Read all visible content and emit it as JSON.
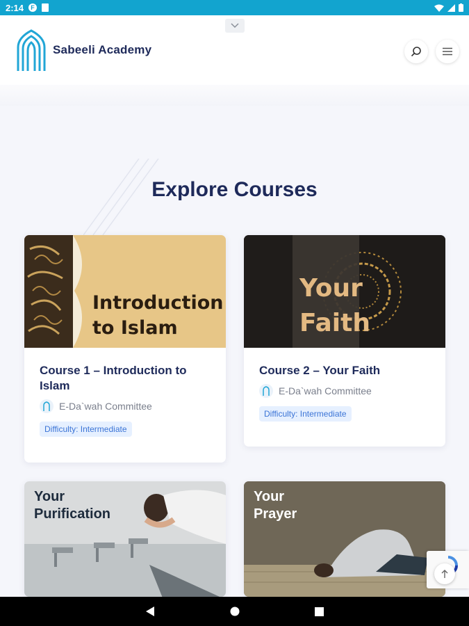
{
  "status_bar": {
    "time": "2:14",
    "notif_icon": "F",
    "icons": [
      "wifi-icon",
      "signal-icon",
      "battery-icon"
    ]
  },
  "header": {
    "brand_name": "Sabeeli Academy",
    "icons": [
      "chevron-down-icon",
      "search-icon",
      "menu-icon"
    ]
  },
  "main": {
    "section_title": "Explore Courses",
    "courses": [
      {
        "title": "Course 1 – Introduction to Islam",
        "image_caption_line1": "Introduction",
        "image_caption_line2": "to Islam",
        "author": "E-Da`wah Committee",
        "difficulty": "Difficulty: Intermediate"
      },
      {
        "title": "Course 2 – Your Faith",
        "image_caption_line1": "Your",
        "image_caption_line2": "Faith",
        "author": "E-Da`wah Committee",
        "difficulty": "Difficulty: Intermediate"
      },
      {
        "image_caption_line1": "Your",
        "image_caption_line2": "Purification"
      },
      {
        "image_caption_line1": "Your",
        "image_caption_line2": "Prayer"
      }
    ]
  },
  "colors": {
    "status_bar": "#12a4cf",
    "brand_text": "#1e2a5a",
    "badge_bg": "#e6f0ff",
    "badge_text": "#3b74d6"
  },
  "nav_bar": {
    "icons": [
      "back-icon",
      "home-icon",
      "recents-icon"
    ]
  }
}
